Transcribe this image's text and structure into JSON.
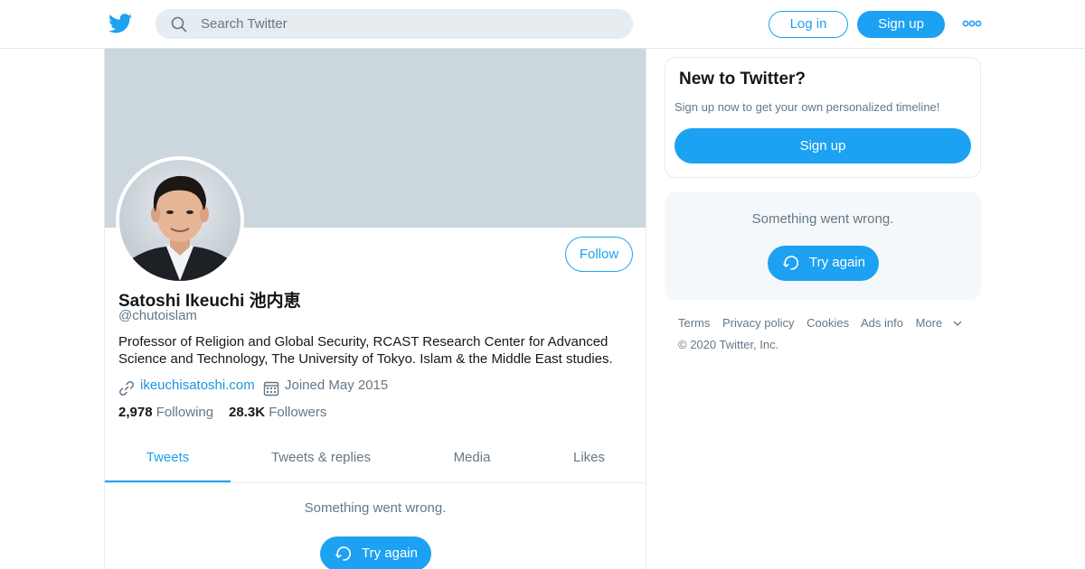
{
  "header": {
    "search_placeholder": "Search Twitter",
    "login_label": "Log in",
    "signup_label": "Sign up",
    "logo_icon": "twitter-bird-icon",
    "more_icon": "more-dots-icon"
  },
  "profile": {
    "name": "Satoshi Ikeuchi 池内恵",
    "handle": "@chutoislam",
    "bio": "Professor of Religion and Global Security, RCAST Research Center for Advanced Science and Technology, The University of Tokyo. Islam & the Middle East studies.",
    "website": "ikeuchisatoshi.com",
    "joined": "Joined May 2015",
    "following_count": "2,978",
    "following_label": "Following",
    "followers_count": "28.3K",
    "followers_label": "Followers",
    "follow_label": "Follow"
  },
  "tabs": [
    {
      "label": "Tweets",
      "active": true
    },
    {
      "label": "Tweets & replies",
      "active": false
    },
    {
      "label": "Media",
      "active": false
    },
    {
      "label": "Likes",
      "active": false
    }
  ],
  "timeline": {
    "error_text": "Something went wrong.",
    "retry_label": "Try again"
  },
  "sidebar": {
    "new_title": "New to Twitter?",
    "new_subtitle": "Sign up now to get your own personalized timeline!",
    "signup_label": "Sign up",
    "error_text": "Something went wrong.",
    "retry_label": "Try again"
  },
  "footer": {
    "links": [
      "Terms",
      "Privacy policy",
      "Cookies",
      "Ads info",
      "More"
    ],
    "copyright": "© 2020 Twitter, Inc."
  },
  "colors": {
    "brand": "#1da1f2",
    "banner": "#ccd6dd",
    "muted_text": "#657786"
  }
}
